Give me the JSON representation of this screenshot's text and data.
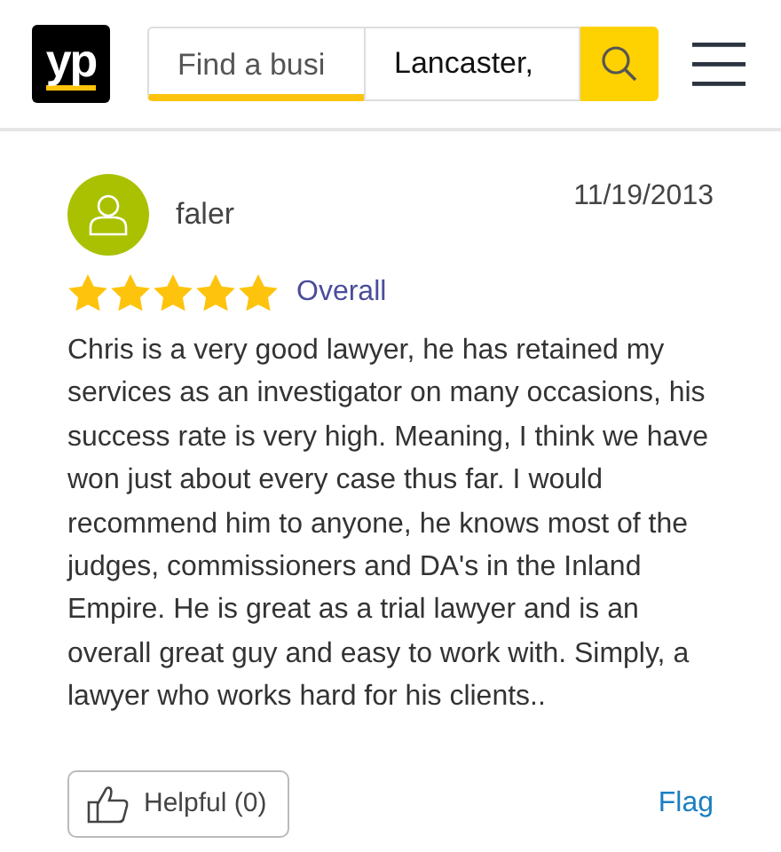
{
  "header": {
    "logo": "yp",
    "search": {
      "placeholder": "Find a busi"
    },
    "location": {
      "value": "Lancaster,"
    }
  },
  "review": {
    "author": "faler",
    "date": "11/19/2013",
    "stars": 5,
    "rating_label": "Overall",
    "text": "Chris is a very good lawyer, he has retained my services as an investigator on many occasions, his success rate is very high. Meaning, I think we have won just about every case thus far. I would recommend him to anyone, he knows most of the judges, commissioners and DA's in the Inland Empire. He is great as a trial lawyer and is an overall great guy and easy to work with. Simply, a lawyer who works hard for his clients..",
    "helpful_button": "Helpful (0)",
    "flag_link": "Flag"
  }
}
